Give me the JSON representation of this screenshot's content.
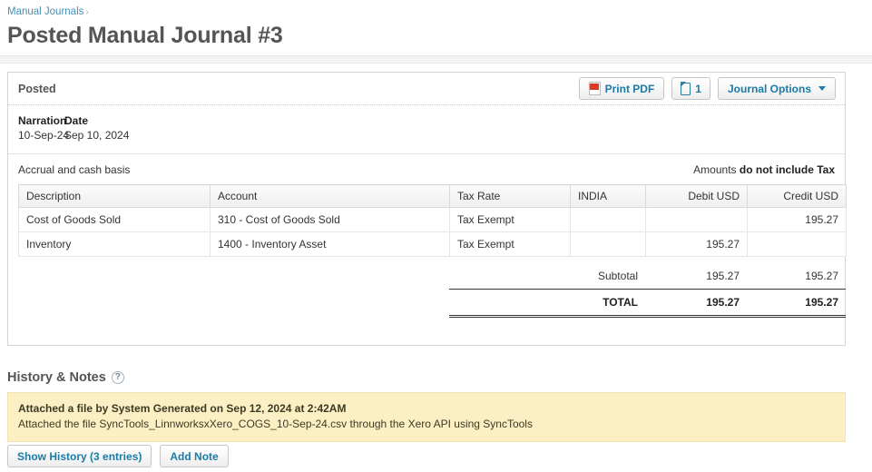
{
  "breadcrumb": {
    "parent": "Manual Journals",
    "separator": "›"
  },
  "page_title": "Posted Manual Journal #3",
  "card": {
    "status": "Posted",
    "actions": {
      "print_pdf": "Print PDF",
      "attachment_count": "1",
      "journal_options": "Journal Options"
    },
    "meta": {
      "narration_label": "Narration",
      "narration_value": "10-Sep-24",
      "date_label": "Date",
      "date_value": "Sep 10, 2024"
    },
    "basis_text": "Accrual and cash basis",
    "amounts_note_prefix": "Amounts",
    "amounts_note_strong": "do not include Tax",
    "table": {
      "columns": [
        "Description",
        "Account",
        "Tax Rate",
        "INDIA",
        "Debit USD",
        "Credit USD"
      ],
      "rows": [
        {
          "description": "Cost of Goods Sold",
          "account": "310 - Cost of Goods Sold",
          "tax_rate": "Tax Exempt",
          "india": "",
          "debit": "",
          "credit": "195.27"
        },
        {
          "description": "Inventory",
          "account": "1400 - Inventory Asset",
          "tax_rate": "Tax Exempt",
          "india": "",
          "debit": "195.27",
          "credit": ""
        }
      ],
      "subtotal": {
        "label": "Subtotal",
        "debit": "195.27",
        "credit": "195.27"
      },
      "total": {
        "label": "TOTAL",
        "debit": "195.27",
        "credit": "195.27"
      }
    }
  },
  "history": {
    "title": "History & Notes",
    "help_glyph": "?",
    "note": {
      "title": "Attached a file by System Generated on Sep 12, 2024 at 2:42AM",
      "body": "Attached the file SyncTools_LinnworksxXero_COGS_10-Sep-24.csv through the Xero API using SyncTools"
    },
    "show_history_label": "Show History (3 entries)",
    "add_note_label": "Add Note"
  },
  "colors": {
    "link": "#4a8fb5",
    "button_text": "#1a7ba8",
    "note_bg": "#fcefc3",
    "pdf_red": "#d93b2b"
  }
}
